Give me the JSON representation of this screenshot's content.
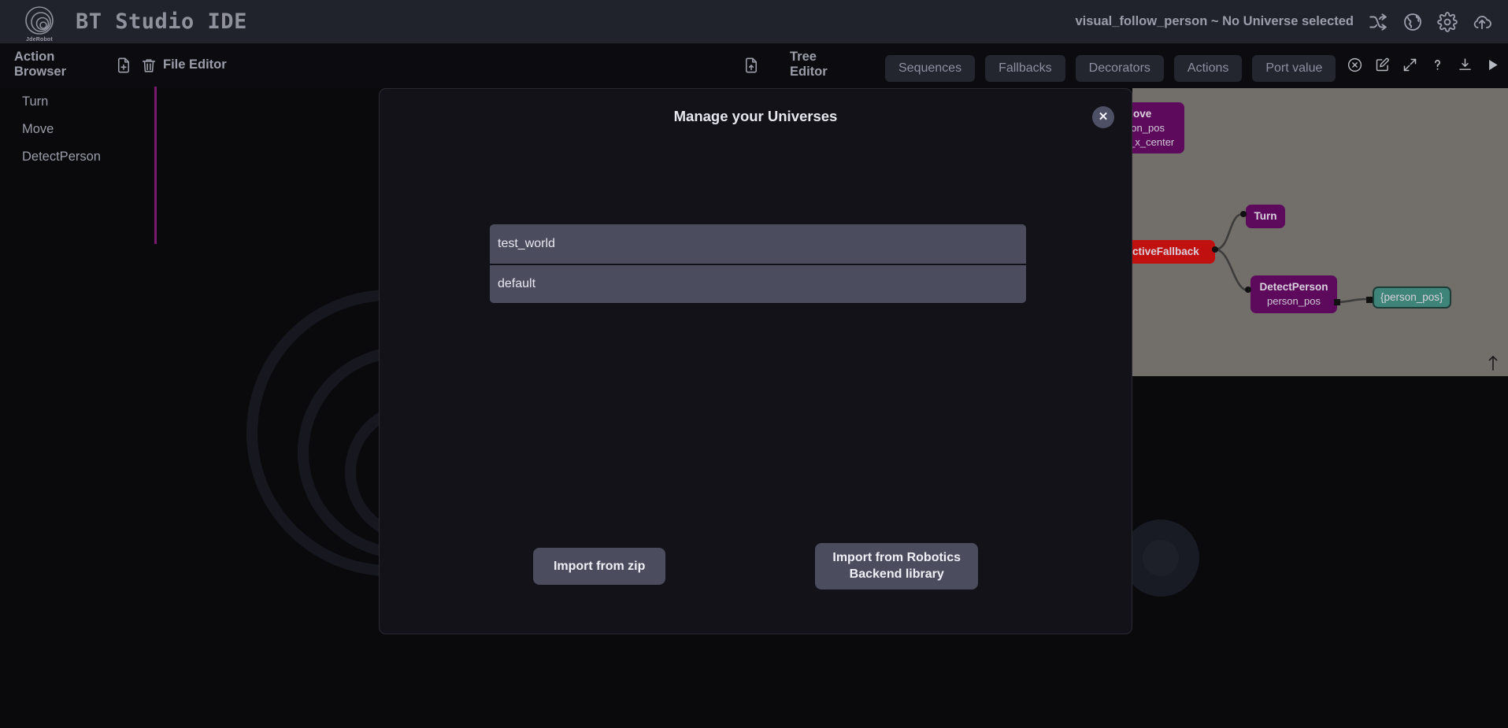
{
  "header": {
    "app_title": "BT Studio IDE",
    "logo_caption": "JdeRobot",
    "project_status": "visual_follow_person ~ No Universe selected",
    "icons": [
      {
        "name": "shuffle-icon",
        "label": "shuffle"
      },
      {
        "name": "globe-icon",
        "label": "globe"
      },
      {
        "name": "gear-icon",
        "label": "settings"
      },
      {
        "name": "cloud-upload-icon",
        "label": "upload"
      }
    ]
  },
  "toolbar": {
    "action_browser_title": "Action Browser",
    "file_editor_title": "File Editor",
    "tree_editor_title": "Tree Editor",
    "new_file_icon": "new-file-icon",
    "delete_file_icon": "trash-icon",
    "save_tree_icon": "save-file-icon",
    "tabs": [
      {
        "label": "Sequences"
      },
      {
        "label": "Fallbacks"
      },
      {
        "label": "Decorators"
      },
      {
        "label": "Actions"
      },
      {
        "label": "Port value"
      }
    ],
    "tool_icons": [
      {
        "name": "circle-x-icon"
      },
      {
        "name": "edit-square-icon"
      },
      {
        "name": "fullscreen-icon"
      },
      {
        "name": "help-icon"
      },
      {
        "name": "download-icon"
      },
      {
        "name": "play-icon"
      },
      {
        "name": "refresh-icon"
      }
    ]
  },
  "action_browser": {
    "items": [
      {
        "label": "Turn"
      },
      {
        "label": "Move"
      },
      {
        "label": "DetectPerson"
      }
    ]
  },
  "tree_canvas": {
    "nodes": [
      {
        "name": "Move",
        "ports": [
          "person_pos",
          "image_x_center"
        ],
        "type": "action"
      },
      {
        "name": "ReactiveFallback",
        "ports": [],
        "type": "fallback"
      },
      {
        "name": "Turn",
        "ports": [],
        "type": "action"
      },
      {
        "name": "DetectPerson",
        "ports": [
          "person_pos"
        ],
        "type": "action"
      },
      {
        "name": "{person_pos}",
        "ports": [],
        "type": "blackboard"
      }
    ],
    "scroll_arrow_icon": "arrow-up-icon"
  },
  "modal": {
    "title": "Manage your Universes",
    "close_label": "✕",
    "universes": [
      {
        "name": "test_world"
      },
      {
        "name": "default"
      }
    ],
    "import_zip_label": "Import from zip",
    "import_robotics_label_line1": "Import from Robotics",
    "import_robotics_label_line2": "Backend library"
  },
  "colors": {
    "header_bg": "#20222c",
    "page_bg": "#0a0a0d",
    "canvas_bg": "#726f6a",
    "accent_purple": "#7a1a6e",
    "node_action": "#5d0a5d",
    "node_fallback": "#c01010",
    "node_blackboard": "#3e8478",
    "modal_bg": "#121218",
    "list_item_bg": "#4b4c5e"
  }
}
